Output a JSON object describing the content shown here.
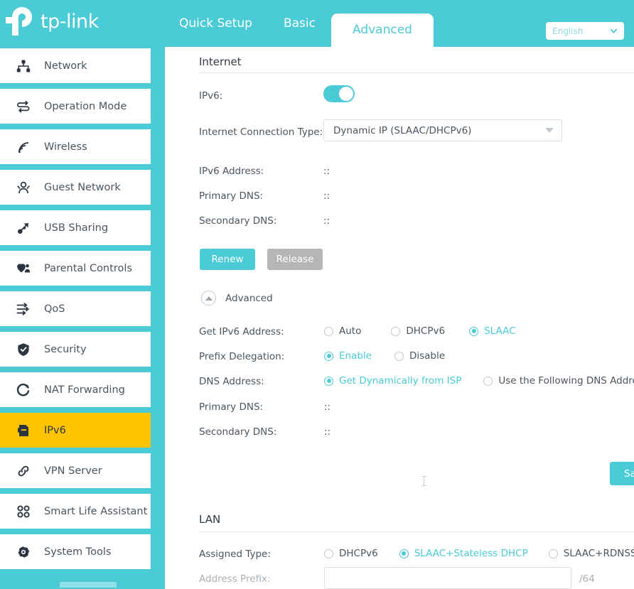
{
  "brand": {
    "name": "tp-link",
    "logo_color": "#FFFFFF"
  },
  "header": {
    "background_color": "#4ACBD6",
    "tabs": [
      {
        "label": "Quick Setup",
        "active": false
      },
      {
        "label": "Basic",
        "active": false
      },
      {
        "label": "Advanced",
        "active": true
      }
    ],
    "language": {
      "selected": "English",
      "icon": "chevron-down-icon"
    }
  },
  "sidebar": {
    "background_color": "#4ACBD6",
    "active_item_color": "#FFC400",
    "items": [
      {
        "label": "Network",
        "icon": "network-icon",
        "active": false
      },
      {
        "label": "Operation Mode",
        "icon": "operation-mode-icon",
        "active": false
      },
      {
        "label": "Wireless",
        "icon": "wireless-signal-icon",
        "active": false
      },
      {
        "label": "Guest Network",
        "icon": "guest-users-icon",
        "active": false
      },
      {
        "label": "USB Sharing",
        "icon": "usb-icon",
        "active": false
      },
      {
        "label": "Parental Controls",
        "icon": "parental-controls-icon",
        "active": false
      },
      {
        "label": "QoS",
        "icon": "qos-sliders-icon",
        "active": false
      },
      {
        "label": "Security",
        "icon": "shield-icon",
        "active": false
      },
      {
        "label": "NAT Forwarding",
        "icon": "nat-forwarding-icon",
        "active": false
      },
      {
        "label": "IPv6",
        "icon": "ipv6-document-icon",
        "active": true
      },
      {
        "label": "VPN Server",
        "icon": "vpn-link-icon",
        "active": false
      },
      {
        "label": "Smart Life Assistant",
        "icon": "smart-life-grid-icon",
        "active": false
      },
      {
        "label": "System Tools",
        "icon": "gear-icon",
        "active": false
      }
    ]
  },
  "internet": {
    "section_title": "Internet",
    "ipv6_label": "IPv6:",
    "ipv6_enabled": true,
    "connection_type_label": "Internet Connection Type:",
    "connection_type_value": "Dynamic IP (SLAAC/DHCPv6)",
    "ipv6_address_label": "IPv6 Address:",
    "ipv6_address_value": "::",
    "primary_dns_label": "Primary DNS:",
    "primary_dns_value": "::",
    "secondary_dns_label": "Secondary DNS:",
    "secondary_dns_value": "::",
    "renew_button": "Renew",
    "release_button": "Release"
  },
  "advanced": {
    "toggle_label": "Advanced",
    "get_ipv6_address": {
      "label": "Get IPv6 Address:",
      "options": [
        {
          "label": "Auto",
          "checked": false
        },
        {
          "label": "DHCPv6",
          "checked": false
        },
        {
          "label": "SLAAC",
          "checked": true
        }
      ]
    },
    "prefix_delegation": {
      "label": "Prefix Delegation:",
      "options": [
        {
          "label": "Enable",
          "checked": true
        },
        {
          "label": "Disable",
          "checked": false
        }
      ]
    },
    "dns_address": {
      "label": "DNS Address:",
      "options": [
        {
          "label": "Get Dynamically from ISP",
          "checked": true
        },
        {
          "label": "Use the Following DNS Addresses",
          "checked": false
        }
      ]
    },
    "primary_dns_label": "Primary DNS:",
    "primary_dns_value": "::",
    "secondary_dns_label": "Secondary DNS:",
    "secondary_dns_value": "::",
    "save_button": "Save"
  },
  "lan": {
    "section_title": "LAN",
    "assigned_type": {
      "label": "Assigned Type:",
      "options": [
        {
          "label": "DHCPv6",
          "checked": false
        },
        {
          "label": "SLAAC+Stateless DHCP",
          "checked": true
        },
        {
          "label": "SLAAC+RDNSS",
          "checked": false
        }
      ]
    },
    "address_prefix_label": "Address Prefix:",
    "address_prefix_value": "",
    "address_prefix_suffix": "/64"
  },
  "colors": {
    "accent_teal": "#4ACBD6",
    "highlight_amber": "#FFC400",
    "disabled_gray": "#B6B6B6",
    "text_primary": "#4A5560",
    "text_muted": "#A9B0B6"
  }
}
